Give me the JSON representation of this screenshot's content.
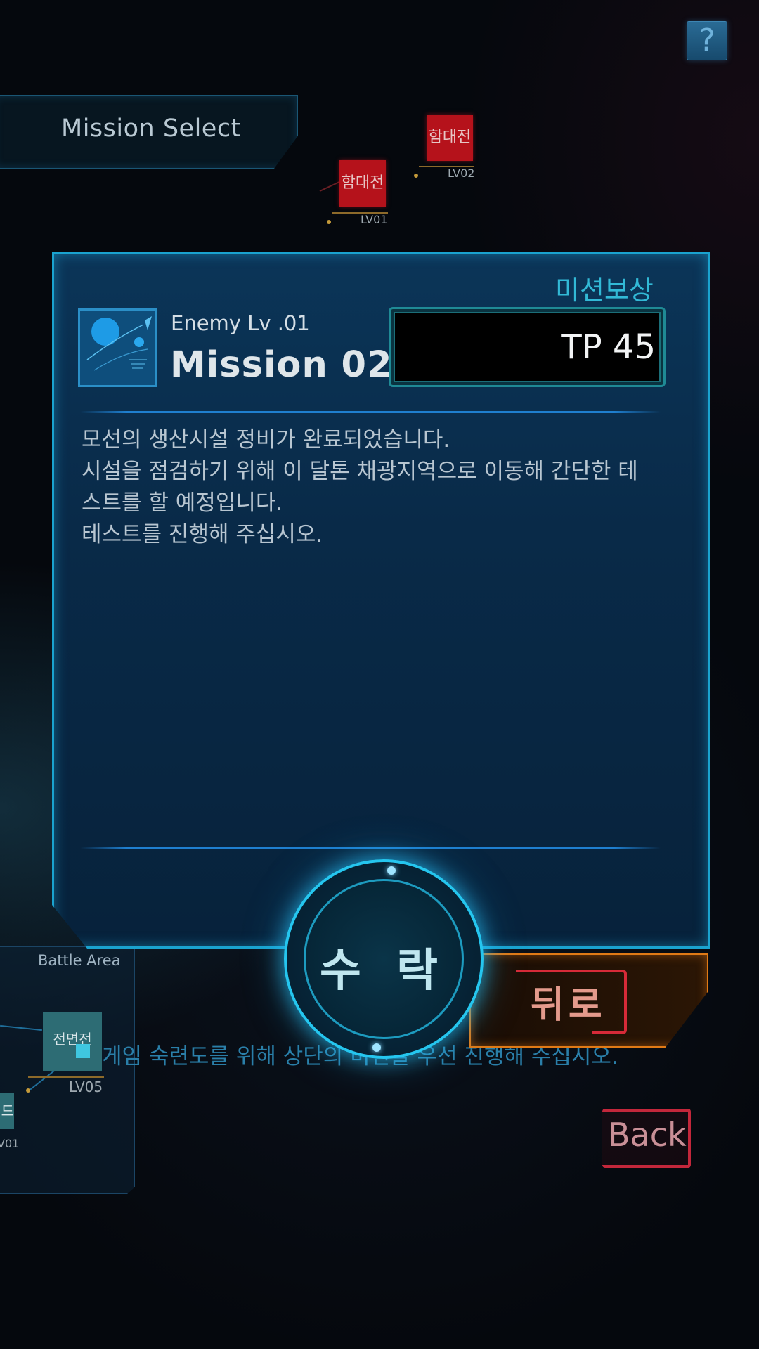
{
  "help": {
    "label": "?"
  },
  "header": {
    "title": "Mission Select"
  },
  "map_nodes": [
    {
      "label": "함대전",
      "level": "LV02"
    },
    {
      "label": "함대전",
      "level": "LV01"
    }
  ],
  "mission": {
    "reward_title": "미션보상",
    "enemy_level": "Enemy Lv .01",
    "name": "Mission 02",
    "reward_value": "TP 45",
    "description": [
      "모선의 생산시설 정비가 완료되었습니다.",
      "시설을 점검하기 위해 이 달톤 채광지역으로 이동해 간단한 테",
      "스트를 할 예정입니다.",
      "테스트를 진행해 주십시오."
    ]
  },
  "buttons": {
    "accept": "수 락",
    "back_ko": "뒤로",
    "back_en": "Back"
  },
  "battle_area": {
    "label": "Battle Area",
    "node_label": "전면전",
    "node_level": "LV05",
    "partial_node_label": "드",
    "partial_node_level": "V01"
  },
  "hint": "게임 숙련도를 위해 상단의 미션을 우선 진행해 주십시오.",
  "colors": {
    "panel_border": "#1aa3cf",
    "reward_title": "#32b9d6",
    "accept_ring": "#25c6ef",
    "back_ko_border": "#e07a16",
    "back_accent": "#d62a38",
    "node_red": "#b5121b"
  }
}
